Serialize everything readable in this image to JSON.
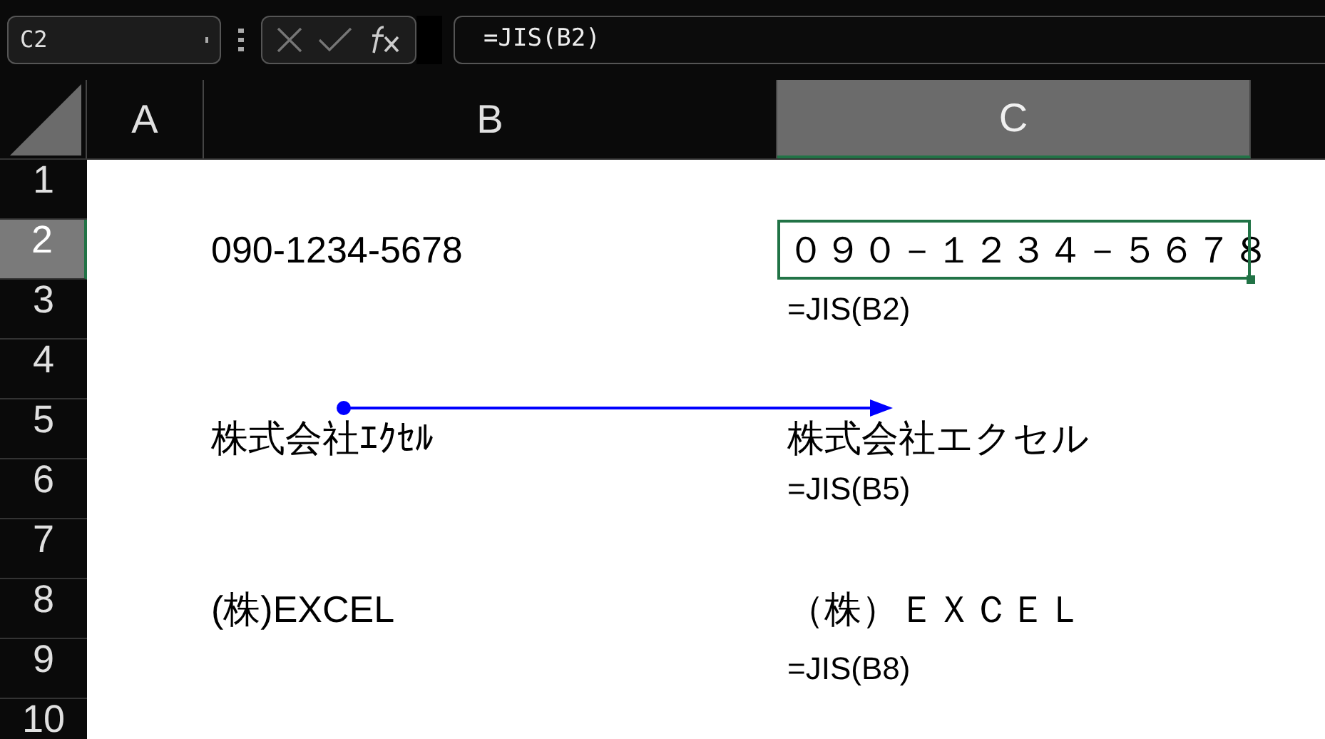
{
  "name_box": {
    "value": "C2"
  },
  "formula_bar": {
    "value": "=JIS(B2)"
  },
  "columns": [
    {
      "label": "A",
      "selected": false
    },
    {
      "label": "B",
      "selected": false
    },
    {
      "label": "C",
      "selected": true
    }
  ],
  "rows": [
    {
      "label": "1",
      "selected": false
    },
    {
      "label": "2",
      "selected": true,
      "b": {
        "text": "090-1234-5678",
        "active": false
      },
      "c": {
        "text": "０９０－１２３４－５６７８",
        "active": true
      }
    },
    {
      "label": "3",
      "selected": false,
      "c": {
        "text": "=JIS(B2)",
        "active": false
      }
    },
    {
      "label": "4",
      "selected": false
    },
    {
      "label": "5",
      "selected": false,
      "b": {
        "text": "株式会社ｴｸｾﾙ",
        "active": false
      },
      "c": {
        "text": "株式会社エクセル",
        "active": false
      }
    },
    {
      "label": "6",
      "selected": false,
      "c": {
        "text": "=JIS(B5)",
        "active": false
      }
    },
    {
      "label": "7",
      "selected": false
    },
    {
      "label": "8",
      "selected": false,
      "b": {
        "text": "(株)EXCEL",
        "active": false
      },
      "c": {
        "text": "（株）ＥＸＣＥＬ",
        "active": false
      }
    },
    {
      "label": "9",
      "selected": false,
      "c": {
        "text": "=JIS(B8)",
        "active": false
      }
    },
    {
      "label": "10",
      "selected": false
    }
  ]
}
